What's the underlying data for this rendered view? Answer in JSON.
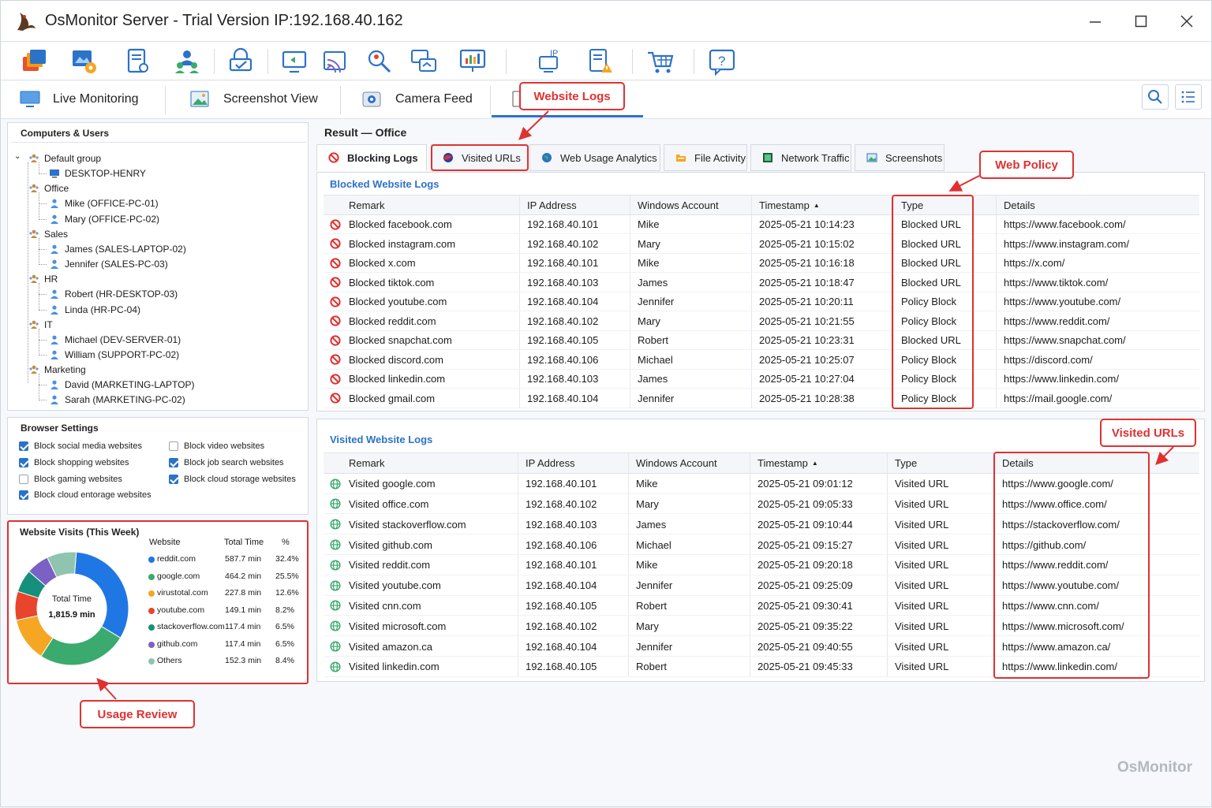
{
  "window": {
    "title": "OsMonitor Server - Trial Version IP:192.168.40.162"
  },
  "toolbar_icons": [
    "windows-icon",
    "settings-map-icon",
    "policy-settings-icon",
    "users-icon",
    "lock-monitor-icon",
    "remote-control-icon",
    "broadcast-icon",
    "search-users-icon",
    "screen-sync-icon",
    "report-chart-icon",
    "ip-icon",
    "alert-doc-icon",
    "cart-icon",
    "help-icon"
  ],
  "view_tabs": [
    {
      "label": "Live Monitoring",
      "icon": "monitor-icon"
    },
    {
      "label": "Screenshot View",
      "icon": "image-icon"
    },
    {
      "label": "Camera Feed",
      "icon": "camera-icon"
    },
    {
      "label": "",
      "icon": "clipboard-icon"
    }
  ],
  "tree": {
    "title": "Computers & Users",
    "groups": [
      {
        "name": "Default group",
        "children": [
          "DESKTOP-HENRY"
        ]
      },
      {
        "name": "Office",
        "children": [
          "Mike  (OFFICE-PC-01)",
          "Mary  (OFFICE-PC-02)"
        ]
      },
      {
        "name": "Sales",
        "children": [
          "James  (SALES-LAPTOP-02)",
          "Jennifer  (SALES-PC-03)"
        ]
      },
      {
        "name": "HR",
        "children": [
          "Robert  (HR-DESKTOP-03)",
          "Linda  (HR-PC-04)"
        ]
      },
      {
        "name": "IT",
        "children": [
          "Michael  (DEV-SERVER-01)",
          "William  (SUPPORT-PC-02)"
        ]
      },
      {
        "name": "Marketing",
        "children": [
          "David  (MARKETING-LAPTOP)",
          "Sarah  (MARKETING-PC-02)"
        ]
      }
    ]
  },
  "browser_settings": {
    "title": "Browser Settings",
    "items": [
      {
        "label": "Block social media websites",
        "checked": true
      },
      {
        "label": "Block video websites",
        "checked": false
      },
      {
        "label": "Block shopping websites",
        "checked": true
      },
      {
        "label": "Block job search websites",
        "checked": true
      },
      {
        "label": "Block gaming websites",
        "checked": false
      },
      {
        "label": "Block cloud storage websites",
        "checked": true
      },
      {
        "label": "Block cloud entorage websites",
        "checked": true
      }
    ]
  },
  "visits_panel": {
    "title": "Website Visits (This Week)",
    "center_label": "Total Time",
    "center_value": "1,815.9 min",
    "col_website": "Website",
    "col_time": "Total Time",
    "col_pct": "%"
  },
  "chart_data": {
    "type": "pie",
    "title": "Website Visits (This Week)",
    "categories": [
      "reddit.com",
      "google.com",
      "virustotal.com",
      "youtube.com",
      "stackoverflow.com",
      "github.com",
      "Others"
    ],
    "values": [
      32.4,
      25.5,
      12.6,
      8.2,
      6.5,
      6.5,
      8.4
    ],
    "time_labels": [
      "587.7 min",
      "464.2 min",
      "227.8 min",
      "149.1 min",
      "117.4 min",
      "117.4 min",
      "152.3 min"
    ],
    "pct_labels": [
      "32.4%",
      "25.5%",
      "12.6%",
      "8.2%",
      "6.5%",
      "6.5%",
      "8.4%"
    ],
    "colors": [
      "#1f77e4",
      "#3aaa6e",
      "#f5a623",
      "#e8452c",
      "#16907c",
      "#7b61c4",
      "#8fc4ae"
    ]
  },
  "result_title": "Result — Office",
  "subtabs": [
    {
      "label": "Blocking Logs",
      "icon": "block-icon"
    },
    {
      "label": "Visited URLs",
      "icon": "globe-icon"
    },
    {
      "label": "Web Usage Analytics",
      "icon": "analytics-globe-icon"
    },
    {
      "label": "File Activity",
      "icon": "folder-icon"
    },
    {
      "label": "Network Traffic",
      "icon": "network-icon"
    },
    {
      "label": "Screenshots",
      "icon": "screenshot-icon"
    }
  ],
  "blocked": {
    "title": "Blocked Website Logs",
    "columns": [
      "Remark",
      "IP Address",
      "Windows Account",
      "Timestamp",
      "Type",
      "Details"
    ],
    "sort_indicator": "▲",
    "rows": [
      [
        "Blocked facebook.com",
        "192.168.40.101",
        "Mike",
        "2025-05-21 10:14:23",
        "Blocked URL",
        "https://www.facebook.com/"
      ],
      [
        "Blocked instagram.com",
        "192.168.40.102",
        "Mary",
        "2025-05-21 10:15:02",
        "Blocked URL",
        "https://www.instagram.com/"
      ],
      [
        "Blocked x.com",
        "192.168.40.101",
        "Mike",
        "2025-05-21 10:16:18",
        "Blocked URL",
        "https://x.com/"
      ],
      [
        "Blocked tiktok.com",
        "192.168.40.103",
        "James",
        "2025-05-21 10:18:47",
        "Blocked URL",
        "https://www.tiktok.com/"
      ],
      [
        "Blocked youtube.com",
        "192.168.40.104",
        "Jennifer",
        "2025-05-21 10:20:11",
        "Policy Block",
        "https://www.youtube.com/"
      ],
      [
        "Blocked reddit.com",
        "192.168.40.102",
        "Mary",
        "2025-05-21 10:21:55",
        "Policy Block",
        "https://www.reddit.com/"
      ],
      [
        "Blocked snapchat.com",
        "192.168.40.105",
        "Robert",
        "2025-05-21 10:23:31",
        "Blocked URL",
        "https://www.snapchat.com/"
      ],
      [
        "Blocked discord.com",
        "192.168.40.106",
        "Michael",
        "2025-05-21 10:25:07",
        "Policy Block",
        "https://discord.com/"
      ],
      [
        "Blocked linkedin.com",
        "192.168.40.103",
        "James",
        "2025-05-21 10:27:04",
        "Policy Block",
        "https://www.linkedin.com/"
      ],
      [
        "Blocked gmail.com",
        "192.168.40.104",
        "Jennifer",
        "2025-05-21 10:28:38",
        "Policy Block",
        "https://mail.google.com/"
      ]
    ]
  },
  "visited": {
    "title": "Visited Website Logs",
    "columns": [
      "Remark",
      "IP Address",
      "Windows Account",
      "Timestamp",
      "Type",
      "Details"
    ],
    "sort_indicator": "▲",
    "rows": [
      [
        "Visited google.com",
        "192.168.40.101",
        "Mike",
        "2025-05-21 09:01:12",
        "Visited URL",
        "https://www.google.com/"
      ],
      [
        "Visited office.com",
        "192.168.40.102",
        "Mary",
        "2025-05-21 09:05:33",
        "Visited URL",
        "https://www.office.com/"
      ],
      [
        "Visited stackoverflow.com",
        "192.168.40.103",
        "James",
        "2025-05-21 09:10:44",
        "Visited URL",
        "https://stackoverflow.com/"
      ],
      [
        "Visited github.com",
        "192.168.40.106",
        "Michael",
        "2025-05-21 09:15:27",
        "Visited URL",
        "https://github.com/"
      ],
      [
        "Visited reddit.com",
        "192.168.40.101",
        "Mike",
        "2025-05-21 09:20:18",
        "Visited URL",
        "https://www.reddit.com/"
      ],
      [
        "Visited youtube.com",
        "192.168.40.104",
        "Jennifer",
        "2025-05-21 09:25:09",
        "Visited URL",
        "https://www.youtube.com/"
      ],
      [
        "Visited cnn.com",
        "192.168.40.105",
        "Robert",
        "2025-05-21 09:30:41",
        "Visited URL",
        "https://www.cnn.com/"
      ],
      [
        "Visited microsoft.com",
        "192.168.40.102",
        "Mary",
        "2025-05-21 09:35:22",
        "Visited URL",
        "https://www.microsoft.com/"
      ],
      [
        "Visited amazon.ca",
        "192.168.40.104",
        "Jennifer",
        "2025-05-21 09:40:55",
        "Visited URL",
        "https://www.amazon.ca/"
      ],
      [
        "Visited linkedin.com",
        "192.168.40.105",
        "Robert",
        "2025-05-21 09:45:33",
        "Visited URL",
        "https://www.linkedin.com/"
      ]
    ]
  },
  "callouts": {
    "website_logs": "Website Logs",
    "web_policy": "Web Policy",
    "visited_urls": "Visited URLs",
    "usage_review": "Usage Review"
  },
  "watermark": "OsMonitor",
  "colors": {
    "accent": "#2c72c7",
    "callout": "#e03131",
    "block": "#e03131",
    "visit": "#3aaa6e"
  }
}
